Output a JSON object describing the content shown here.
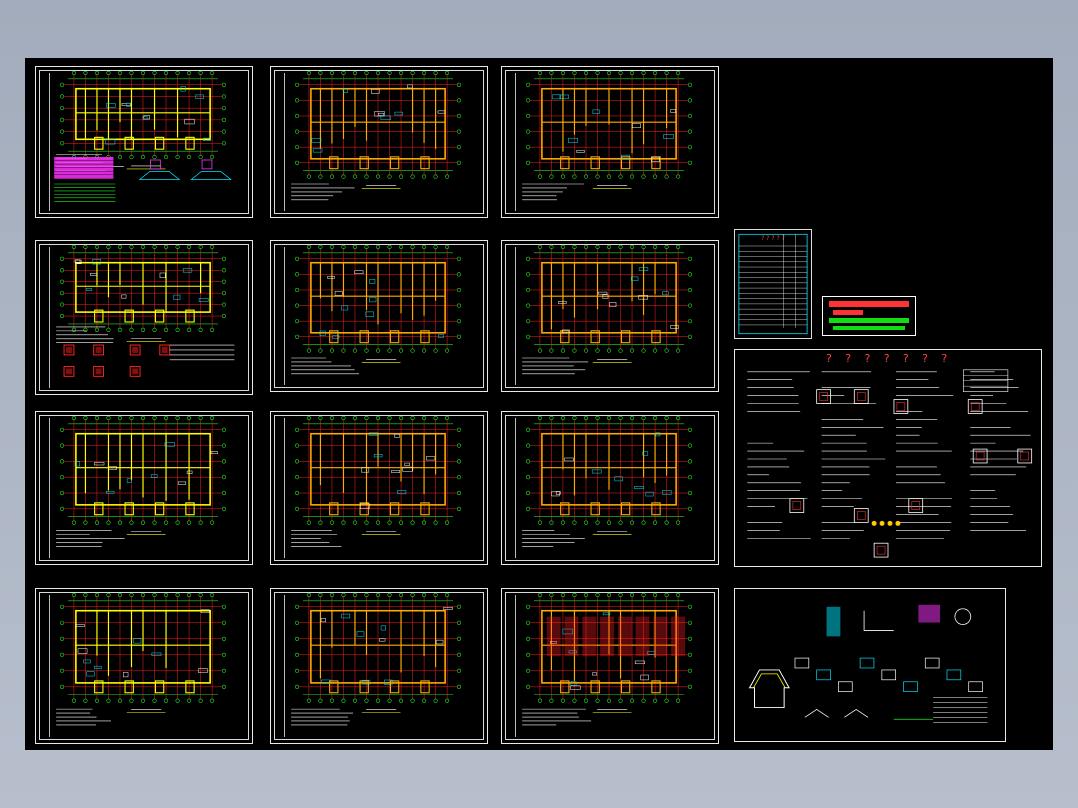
{
  "colors": {
    "background": "#a8b1c0",
    "canvas": "#000000",
    "sheet_border": "#e8e8e8",
    "axis_grid": "#ff2020",
    "axis_bubble": "#22ee22",
    "wall": "#ffff00",
    "wall_orange": "#ffaa00",
    "dim": "#22dd22",
    "detail_cyan": "#00e5ff",
    "detail_magenta": "#ff33ff",
    "text_white": "#ffffff"
  },
  "sheets": [
    {
      "id": "sheet-1",
      "kind": "foundation-plan"
    },
    {
      "id": "sheet-2",
      "kind": "floor-plan"
    },
    {
      "id": "sheet-3",
      "kind": "floor-plan"
    },
    {
      "id": "sheet-4",
      "kind": "floor-plan-with-details"
    },
    {
      "id": "sheet-5",
      "kind": "floor-plan"
    },
    {
      "id": "sheet-6",
      "kind": "floor-plan"
    },
    {
      "id": "sheet-7",
      "kind": "floor-plan"
    },
    {
      "id": "sheet-8",
      "kind": "floor-plan"
    },
    {
      "id": "sheet-9",
      "kind": "floor-plan"
    },
    {
      "id": "sheet-10",
      "kind": "floor-plan"
    },
    {
      "id": "sheet-11",
      "kind": "floor-plan"
    },
    {
      "id": "sheet-12",
      "kind": "roof-plan"
    }
  ],
  "notes_sheet": {
    "title": "? ? ? ? ? ? ?"
  },
  "titleblock": {
    "header": "? ? ? ? ?"
  }
}
